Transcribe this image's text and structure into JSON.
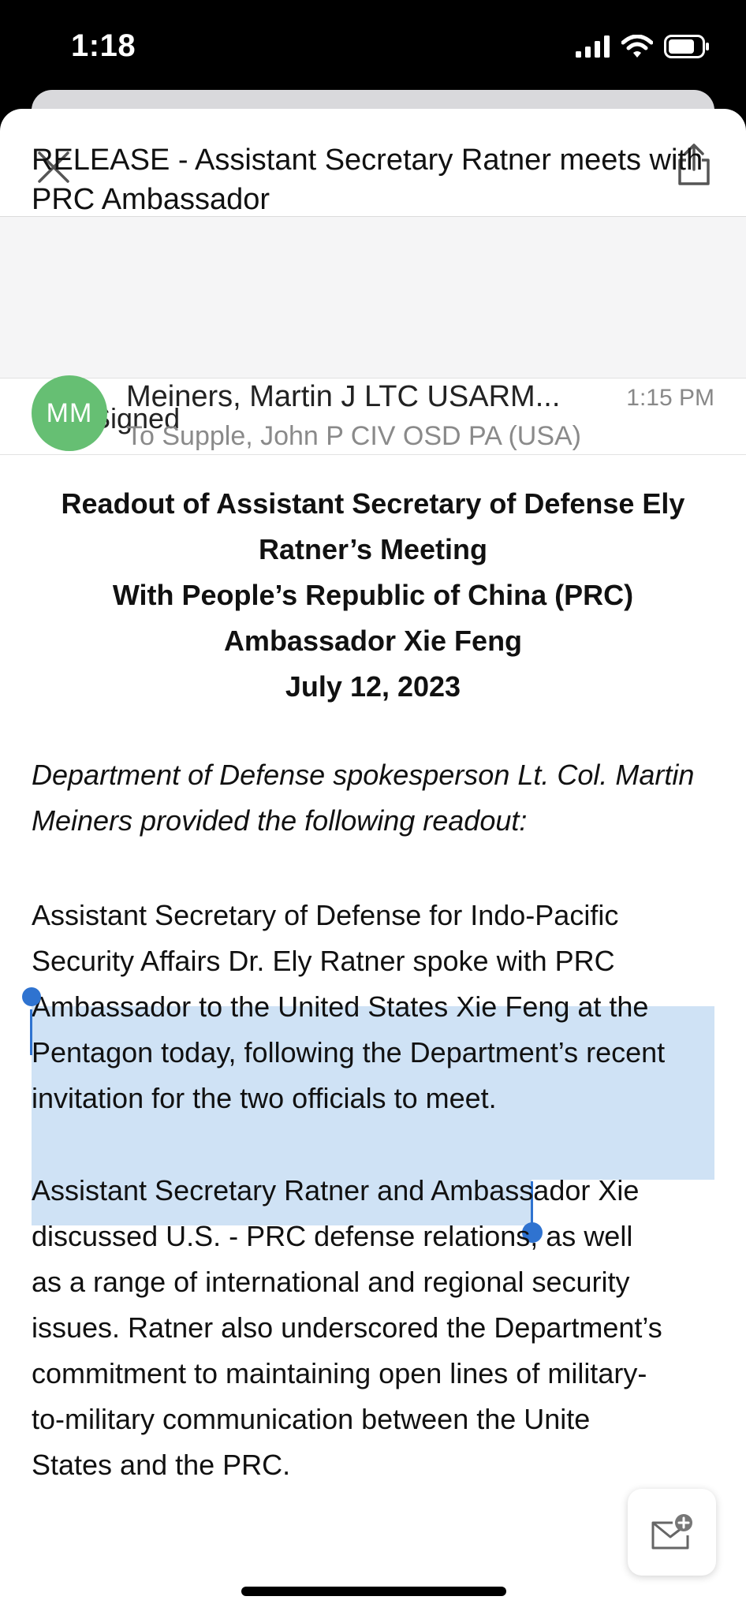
{
  "status_bar": {
    "time": "1:18"
  },
  "email": {
    "subject": "RELEASE - Assistant Secretary Ratner meets with PRC Ambassador",
    "signed_label": "Signed",
    "avatar_initials": "MM",
    "sender": "Meiners, Martin J LTC USARM...",
    "time": "1:15 PM",
    "recipient": "To Supple, John P CIV OSD PA (USA)",
    "heading_lines": [
      "Readout of Assistant Secretary of Defense Ely",
      "Ratner’s Meeting",
      "With People’s Republic of China (PRC)",
      "Ambassador Xie Feng",
      "July 12, 2023"
    ],
    "intro": "Department of Defense spokesperson Lt. Col. Martin Meiners provided the following readout:",
    "paragraph1_lines": [
      "Assistant Secretary of Defense for Indo-Pacific",
      "Security Affairs Dr. Ely Ratner spoke with PRC",
      "Ambassador to the United States Xie Feng at the",
      "Pentagon today, following the Department’s recent",
      "invitation for the two officials to meet."
    ],
    "paragraph2_lines": [
      "Assistant Secretary Ratner and Ambassador Xie",
      "discussed U.S. - PRC defense relations, as well",
      "as a range of international and regional security",
      "issues. Ratner also underscored the Department’s",
      "commitment to maintaining open lines of military-",
      "to-military communication between the Unite",
      "States and the PRC."
    ]
  },
  "icons": {
    "close": "close-icon",
    "share": "share-icon",
    "signed": "verified-badge-icon",
    "compose": "new-mail-icon"
  },
  "colors": {
    "avatar": "#66bf73",
    "signed_badge": "#3aa757",
    "selection": "#cfe2f5",
    "selection_handle": "#2f73d0"
  }
}
